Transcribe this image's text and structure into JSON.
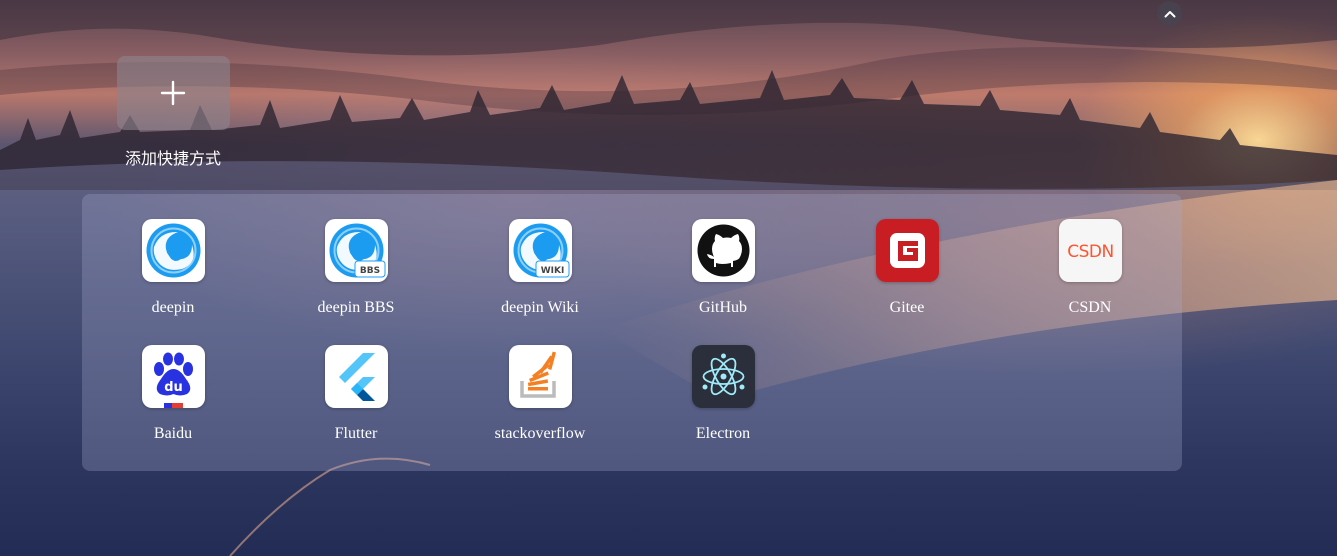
{
  "header": {
    "collapse_icon": "chevron-up-icon"
  },
  "add_shortcut": {
    "label": "添加快捷方式",
    "icon": "plus-icon"
  },
  "shortcuts": [
    {
      "label": "deepin",
      "icon": "deepin-logo-icon"
    },
    {
      "label": "deepin BBS",
      "icon": "deepin-bbs-logo-icon",
      "badge": "BBS"
    },
    {
      "label": "deepin Wiki",
      "icon": "deepin-wiki-logo-icon",
      "badge": "WIKI"
    },
    {
      "label": "GitHub",
      "icon": "github-logo-icon"
    },
    {
      "label": "Gitee",
      "icon": "gitee-logo-icon"
    },
    {
      "label": "CSDN",
      "icon": "csdn-logo-icon",
      "logo_text": "CSDN"
    },
    {
      "label": "Baidu",
      "icon": "baidu-logo-icon",
      "logo_text": "du"
    },
    {
      "label": "Flutter",
      "icon": "flutter-logo-icon"
    },
    {
      "label": "stackoverflow",
      "icon": "stackoverflow-logo-icon"
    },
    {
      "label": "Electron",
      "icon": "electron-logo-icon"
    }
  ],
  "colors": {
    "deepin_blue": "#1c9cf0",
    "gitee_red": "#c71d23",
    "csdn_red": "#fc5531",
    "baidu_blue": "#2932e1",
    "flutter_blue": "#42a5f5",
    "stackoverflow_orange": "#f48024",
    "electron_cyan": "#9feaf9",
    "panel_bg": "rgba(165,170,205,0.30)"
  }
}
